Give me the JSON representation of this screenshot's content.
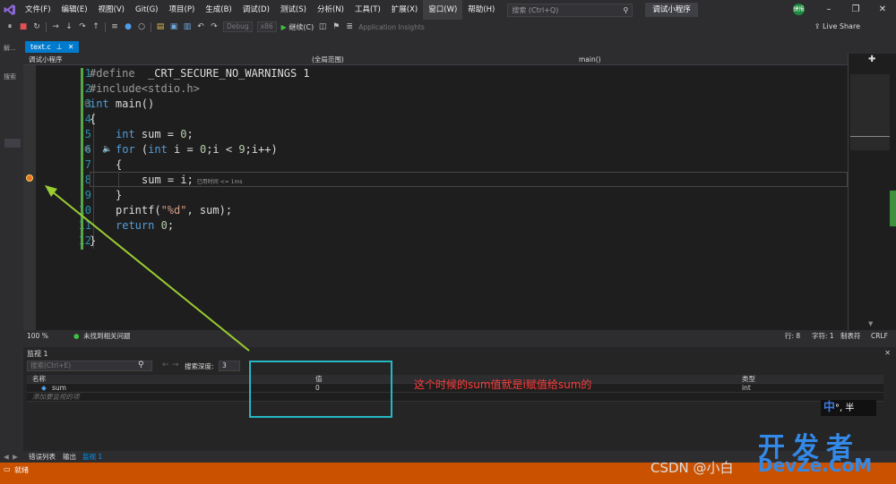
{
  "menubar": {
    "items": [
      "文件(F)",
      "编辑(E)",
      "视图(V)",
      "Git(G)",
      "项目(P)",
      "生成(B)",
      "调试(D)",
      "测试(S)",
      "分析(N)",
      "工具(T)",
      "扩展(X)",
      "窗口(W)",
      "帮助(H)"
    ],
    "search_placeholder": "搜索 (Ctrl+Q)",
    "window_title": "调试小程序",
    "user_initials": "捷报"
  },
  "toolbar": {
    "config": "Debug",
    "platform": "x86",
    "continue_label": "继续(C)",
    "app_insights": "Application Insights",
    "live_share": "Live Share"
  },
  "leftpanel": {
    "tab1": "解...",
    "tab2": "搜索"
  },
  "editor": {
    "file_tab": "text.c",
    "nav_project": "调试小程序",
    "nav_scope": "(全局范围)",
    "nav_function": "main()",
    "line_numbers": [
      "1",
      "2",
      "3",
      "4",
      "5",
      "6",
      "7",
      "8",
      "9",
      "10",
      "11",
      "12"
    ],
    "code": {
      "l1_a": "#define",
      "l1_b": "  _CRT_SECURE_NO_WARNINGS 1",
      "l2": "#include<stdio.h>",
      "l3_kw": "int",
      "l3_rest": " main()",
      "l4": "{",
      "l5_kw": "int",
      "l5_rest": " sum = ",
      "l5_num": "0",
      "l5_end": ";",
      "l6_kw": "for",
      "l6_a": " (",
      "l6_kw2": "int",
      "l6_b": " i = ",
      "l6_num": "0",
      "l6_c": ";i < ",
      "l6_num2": "9",
      "l6_d": ";i++)",
      "l7": "{",
      "l8": "sum = i;",
      "l8_hint": "已用时间 <= 1ms",
      "l9": "}",
      "l10_a": "printf(",
      "l10_str": "\"%d\"",
      "l10_b": ", sum);",
      "l11_kw": "return",
      "l11_sp": " ",
      "l11_num": "0",
      "l11_end": ";",
      "l12": "}"
    },
    "zoom": "100 %",
    "issues": "未找到相关问题",
    "line_info": "行: 8",
    "col_info": "字符: 1",
    "tab_mode": "制表符",
    "eol": "CRLF"
  },
  "watch": {
    "title": "监视 1",
    "search_placeholder": "搜索(Ctrl+E)",
    "depth_label": "搜索深度:",
    "depth_value": "3",
    "col_name": "名称",
    "col_value": "值",
    "col_type": "类型",
    "rows": [
      {
        "name": "sum",
        "value": "0",
        "type": "int"
      }
    ],
    "add_placeholder": "添加要监视的项"
  },
  "annotation": "这个时候的sum值就是i赋值给sum的",
  "bottomtabs": [
    "错误列表",
    "输出",
    "监视 1"
  ],
  "status": {
    "ready": "就绪"
  },
  "watermark": "CSDN @小白",
  "ime": {
    "main": "中",
    "rest": "°, 半"
  },
  "devze": {
    "cn": "开发者",
    "en": "DevZe.CoM"
  },
  "colors": {
    "accent": "#007acc",
    "status_bar": "#ca5100",
    "annotation_red": "#ff3b3b",
    "annotation_box": "#25b8c4",
    "arrow": "#9acd32"
  }
}
